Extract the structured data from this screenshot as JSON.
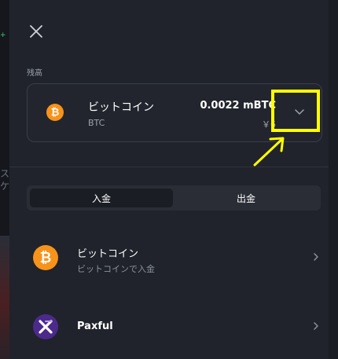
{
  "background_page": {
    "visible_glyphs": [
      "ス",
      "ケ"
    ]
  },
  "balance_section": {
    "label": "残高",
    "coin": {
      "name": "ビットコイン",
      "code": "BTC",
      "amount": "0.0022 mBTC",
      "fiat": "￥6",
      "icon": "bitcoin-icon",
      "icon_glyph": "₿"
    },
    "dropdown_icon": "chevron-down-icon"
  },
  "tabs": [
    {
      "label": "入金",
      "active": true
    },
    {
      "label": "出金",
      "active": false
    }
  ],
  "methods": [
    {
      "title": "ビットコイン",
      "subtitle": "ビットコインで入金",
      "icon": "bitcoin-icon",
      "icon_glyph": "₿"
    },
    {
      "title": "Paxful",
      "subtitle": "",
      "icon": "paxful-icon",
      "icon_glyph": ""
    }
  ],
  "colors": {
    "panel_bg": "#20232b",
    "bitcoin_orange": "#f7931a",
    "paxful_purple": "#4b2a8c",
    "annotation_yellow": "#ffff00"
  },
  "annotation": {
    "type": "highlight-box-with-arrow",
    "target": "dropdown-button"
  }
}
